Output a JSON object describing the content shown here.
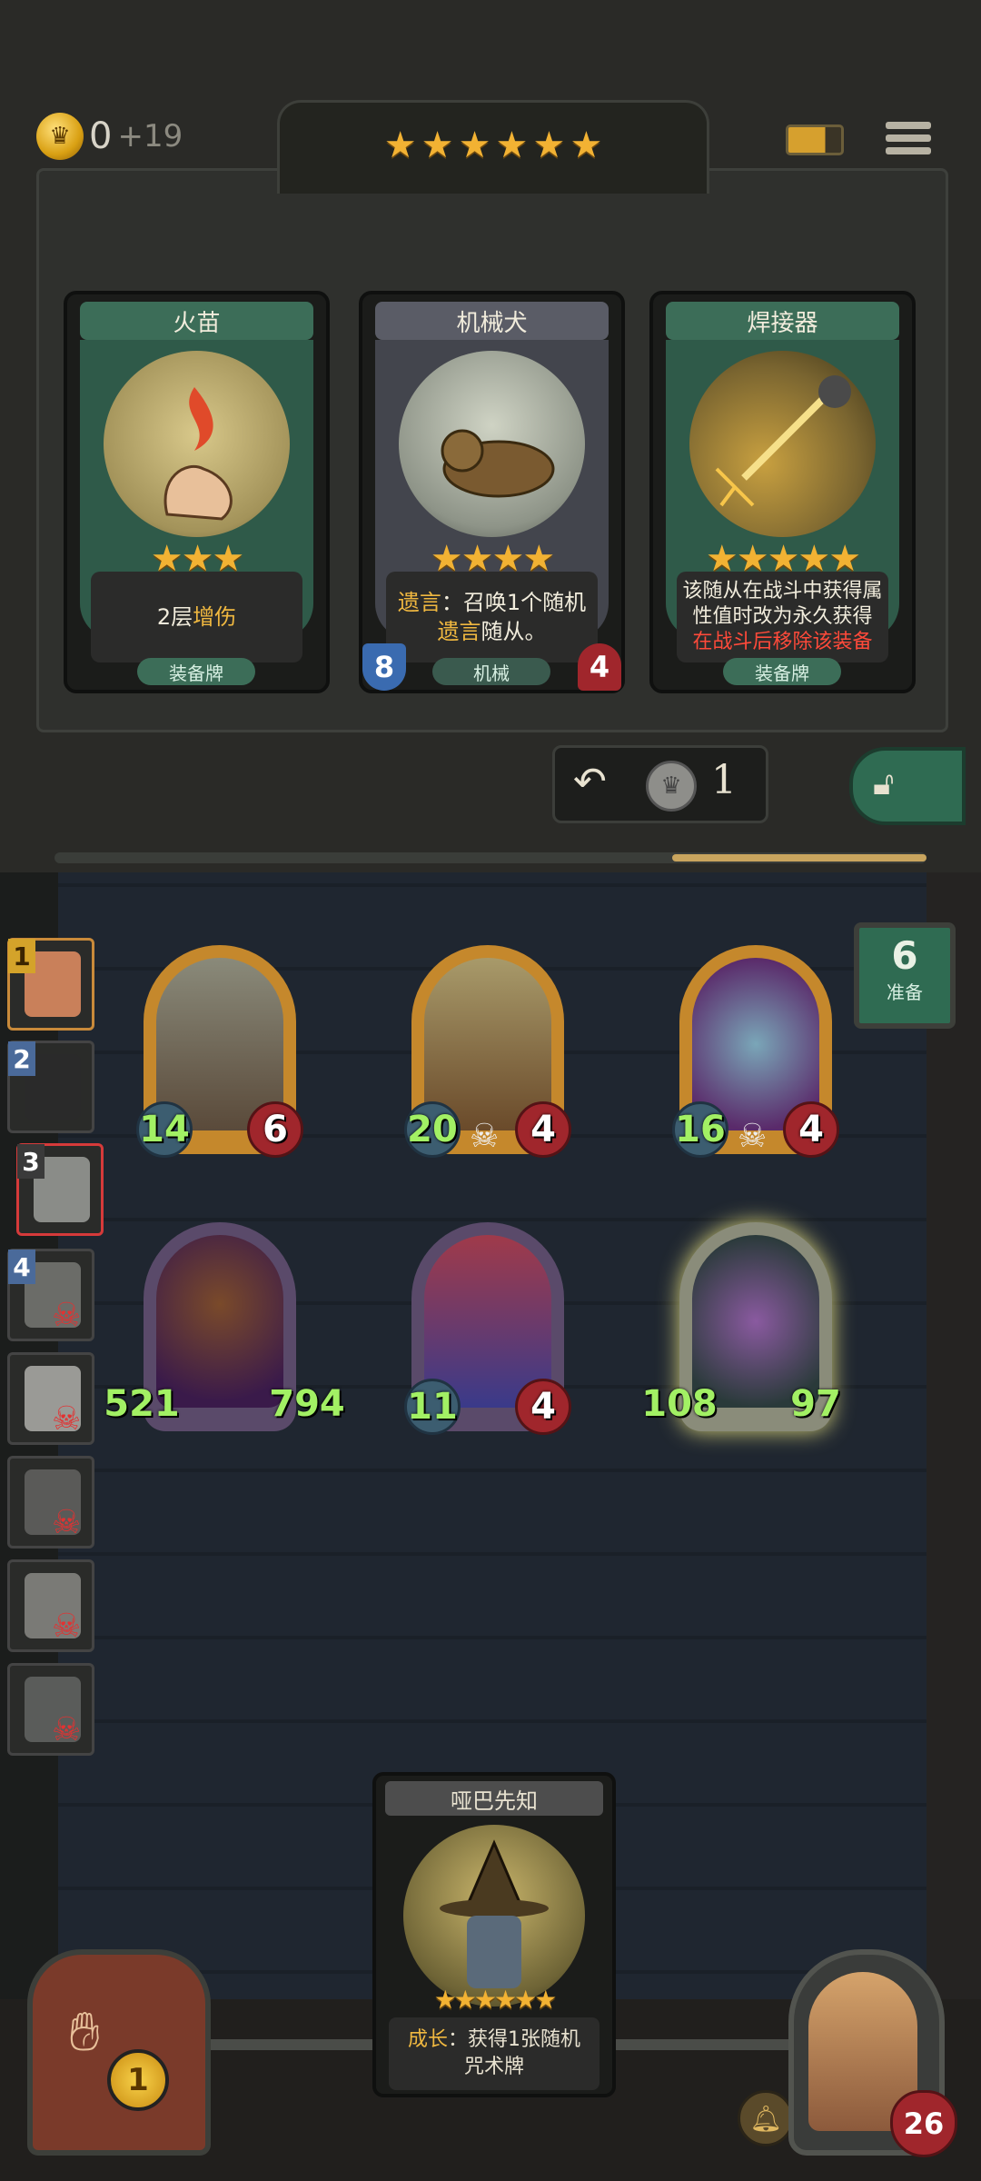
{
  "header": {
    "gold": "0",
    "gold_income": "+19",
    "tavern_stars": 6
  },
  "shop": {
    "cards": [
      {
        "name": "火苗",
        "stars": 3,
        "desc_plain": "2层",
        "desc_hl": "增伤",
        "tag": "装备牌"
      },
      {
        "name": "机械犬",
        "stars": 4,
        "desc_line1_hl": "遗言",
        "desc_line1": "：召唤1个随机",
        "desc_line2_hl": "遗言",
        "desc_line2": "随从。",
        "tag": "机械",
        "attack": "8",
        "health": "4"
      },
      {
        "name": "焊接器",
        "stars": 5,
        "desc_line1": "该随从在战斗中获得属",
        "desc_line2": "性值时改为永久获得",
        "desc_line3": "在战斗后移除该装备",
        "tag": "装备牌"
      }
    ],
    "refresh_cost": "1"
  },
  "ready": {
    "count": "6",
    "label": "准备"
  },
  "players": [
    {
      "rank": "1",
      "dead": false,
      "highlight": false
    },
    {
      "rank": "2",
      "dead": false,
      "highlight": false
    },
    {
      "rank": "3",
      "dead": false,
      "highlight": true
    },
    {
      "rank": "4",
      "dead": true
    },
    {
      "rank": "",
      "dead": true
    },
    {
      "rank": "",
      "dead": true
    },
    {
      "rank": "",
      "dead": true
    },
    {
      "rank": "",
      "dead": true
    }
  ],
  "board": {
    "minions": [
      {
        "attack": "14",
        "health": "6",
        "deathrattle": false
      },
      {
        "attack": "20",
        "health": "4",
        "deathrattle": true
      },
      {
        "attack": "16",
        "health": "4",
        "deathrattle": true
      },
      {
        "attack": "521",
        "health": "794",
        "deathrattle": false
      },
      {
        "attack": "11",
        "health": "4",
        "deathrattle": false
      },
      {
        "attack": "108",
        "health": "97",
        "deathrattle": false
      }
    ]
  },
  "hand_card": {
    "name": "哑巴先知",
    "stars": 6,
    "desc_hl": "成长",
    "desc_line1": "：获得1张随机",
    "desc_line2": "咒术牌"
  },
  "hero": {
    "health": "26",
    "power_cost": "1"
  },
  "colors": {
    "gold": "#f2b233",
    "green_panel": "#2f6b52",
    "red_text": "#ff4a3a",
    "stat_green": "#a2f064"
  }
}
